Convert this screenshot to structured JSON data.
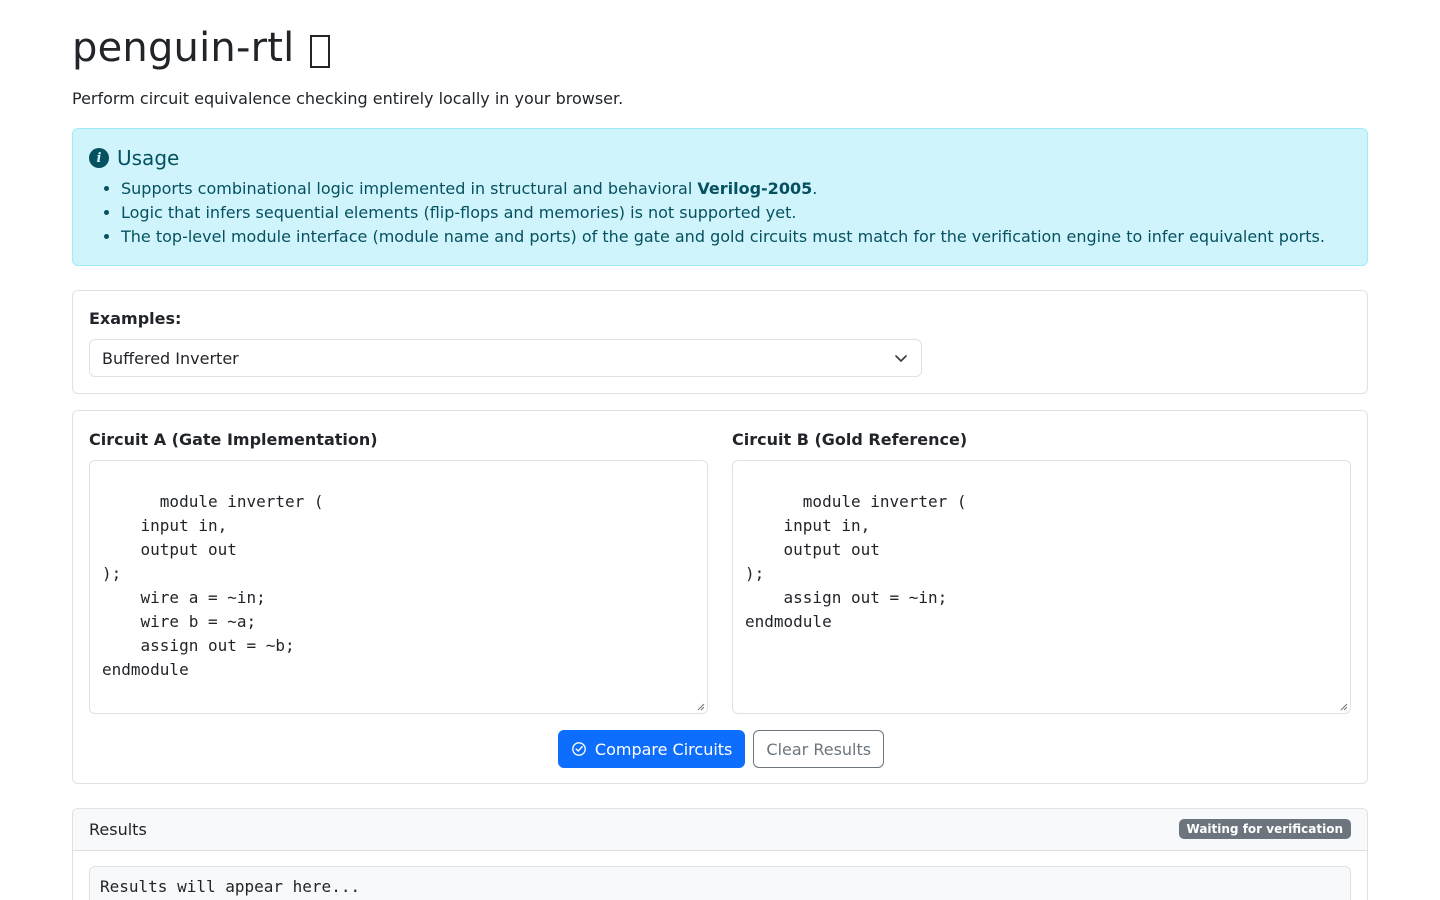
{
  "header": {
    "title": "penguin-rtl",
    "subtitle": "Perform circuit equivalence checking entirely locally in your browser."
  },
  "usage": {
    "title": "Usage",
    "items": [
      {
        "prefix": "Supports combinational logic implemented in structural and behavioral ",
        "bold": "Verilog-2005",
        "suffix": "."
      },
      {
        "text": "Logic that infers sequential elements (flip-flops and memories) is not supported yet."
      },
      {
        "text": "The top-level module interface (module name and ports) of the gate and gold circuits must match for the verification engine to infer equivalent ports."
      }
    ]
  },
  "examples": {
    "label": "Examples:",
    "selected": "Buffered Inverter"
  },
  "circuit_a": {
    "label": "Circuit A (Gate Implementation)",
    "code": "module inverter (\n    input in,\n    output out\n);\n    wire a = ~in;\n    wire b = ~a;\n    assign out = ~b;\nendmodule"
  },
  "circuit_b": {
    "label": "Circuit B (Gold Reference)",
    "code": "module inverter (\n    input in,\n    output out\n);\n    assign out = ~in;\nendmodule"
  },
  "actions": {
    "compare_label": "Compare Circuits",
    "clear_label": "Clear Results"
  },
  "results": {
    "title": "Results",
    "status_badge": "Waiting for verification",
    "placeholder": "Results will appear here..."
  },
  "colors": {
    "primary": "#0d6efd",
    "info_bg": "#cff4fc",
    "info_text": "#055160",
    "badge_bg": "#6c757d"
  },
  "icons": [
    "info-icon",
    "chevron-down-icon",
    "check-circle-icon",
    "resize-handle-icon"
  ]
}
